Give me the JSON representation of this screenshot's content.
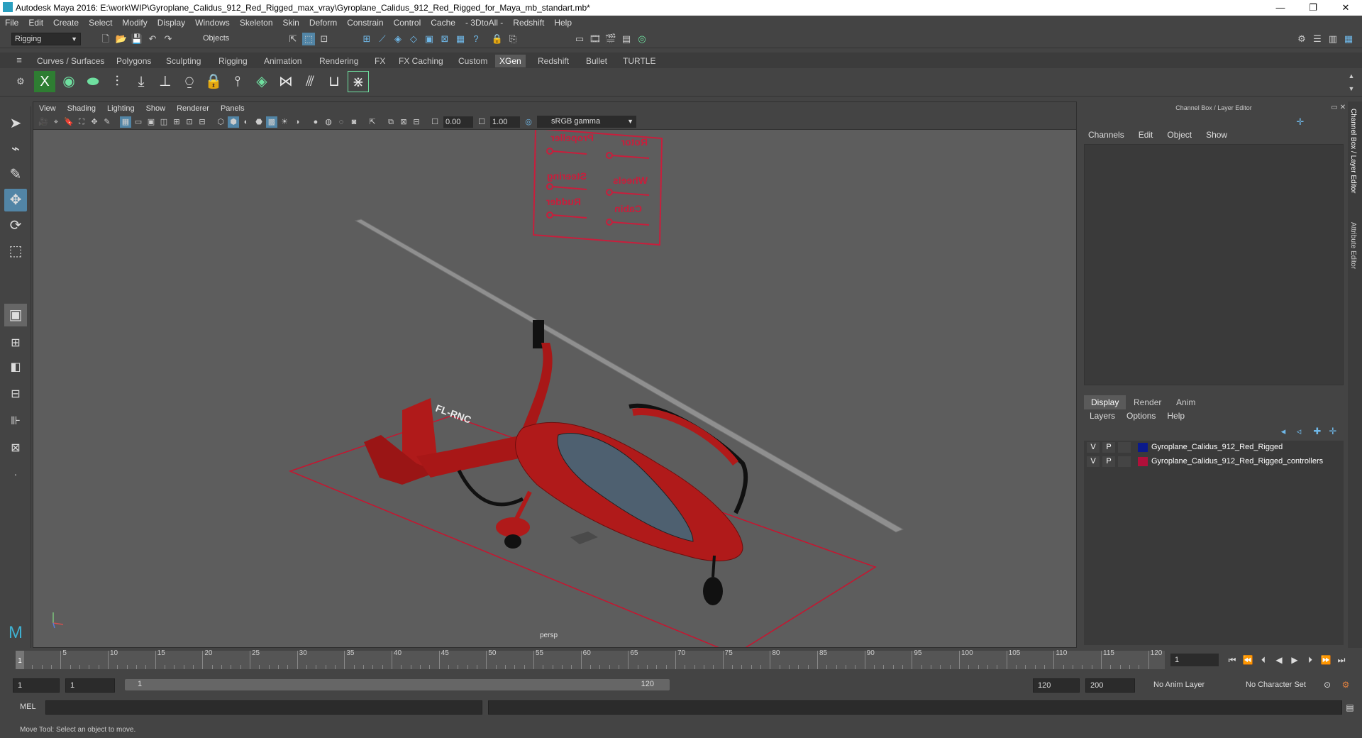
{
  "window": {
    "title": "Autodesk Maya 2016: E:\\work\\WIP\\Gyroplane_Calidus_912_Red_Rigged_max_vray\\Gyroplane_Calidus_912_Red_Rigged_for_Maya_mb_standart.mb*",
    "minimize": "—",
    "maximize": "❐",
    "close": "✕"
  },
  "menubar": [
    "File",
    "Edit",
    "Create",
    "Select",
    "Modify",
    "Display",
    "Windows",
    "Skeleton",
    "Skin",
    "Deform",
    "Constrain",
    "Control",
    "Cache",
    "- 3DtoAll -",
    "Redshift",
    "Help"
  ],
  "statusline": {
    "menuset": "Rigging",
    "selection_mode": "Objects"
  },
  "shelf_tabs": [
    "Curves / Surfaces",
    "Polygons",
    "Sculpting",
    "Rigging",
    "Animation",
    "Rendering",
    "FX",
    "FX Caching",
    "Custom",
    "XGen",
    "Redshift",
    "Bullet",
    "TURTLE"
  ],
  "active_shelf_tab": "XGen",
  "viewport": {
    "menu": [
      "View",
      "Shading",
      "Lighting",
      "Show",
      "Renderer",
      "Panels"
    ],
    "exposure": "0.00",
    "gamma_value": "1.00",
    "color_space": "sRGB gamma",
    "camera": "persp",
    "scene_labels": {
      "propeller": "Propeller",
      "rotor": "Rotor",
      "steering": "Steering",
      "wheels": "Wheels",
      "rudder": "Rudder",
      "cabin": "Cabin",
      "registration": "FL-RNC"
    },
    "colors": {
      "background": "#5d5d5d",
      "body": "#b01a1a",
      "controller": "#c81e3c",
      "rotor": "#8a8a8a"
    }
  },
  "channel_box": {
    "title": "Channel Box / Layer Editor",
    "menu": [
      "Channels",
      "Edit",
      "Object",
      "Show"
    ]
  },
  "layer_editor": {
    "tabs": [
      "Display",
      "Render",
      "Anim"
    ],
    "active_tab": "Display",
    "menu": [
      "Layers",
      "Options",
      "Help"
    ],
    "layers": [
      {
        "v": "V",
        "p": "P",
        "name": "Gyroplane_Calidus_912_Red_Rigged",
        "color": "#0b1a8c"
      },
      {
        "v": "V",
        "p": "P",
        "name": "Gyroplane_Calidus_912_Red_Rigged_controllers",
        "color": "#b0103a"
      }
    ]
  },
  "side_tabs": [
    "Channel Box / Layer Editor",
    "Attribute Editor"
  ],
  "timeline": {
    "current_frame": "1",
    "ticks": [
      "5",
      "10",
      "15",
      "20",
      "25",
      "30",
      "35",
      "40",
      "45",
      "50",
      "55",
      "60",
      "65",
      "70",
      "75",
      "80",
      "85",
      "90",
      "95",
      "100",
      "105",
      "110",
      "115",
      "120"
    ],
    "frame_field": "1"
  },
  "range": {
    "start": "1",
    "playback_start": "1",
    "slider_start": "1",
    "slider_end": "120",
    "playback_end": "120",
    "end": "200",
    "anim_layer": "No Anim Layer",
    "character_set": "No Character Set"
  },
  "command_line": {
    "label": "MEL"
  },
  "help_line": "Move Tool: Select an object to move."
}
